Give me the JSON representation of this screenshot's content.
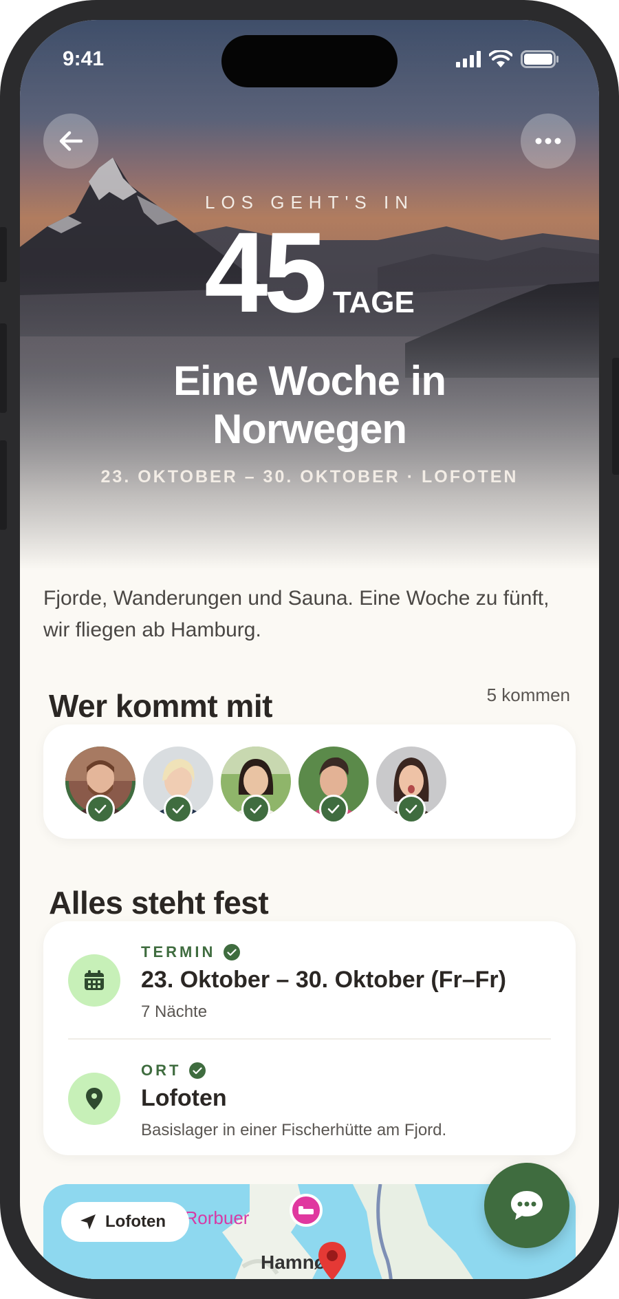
{
  "status_bar": {
    "time": "9:41"
  },
  "hero": {
    "kicker": "LOS GEHT'S IN",
    "countdown_number": "45",
    "countdown_unit": "TAGE",
    "title_line1": "Eine Woche in",
    "title_line2": "Norwegen",
    "meta": "23. OKTOBER – 30. OKTOBER · LOFOTEN"
  },
  "intro": "Fjorde, Wanderungen und Sauna. Eine Woche zu fünft, wir fliegen ab Hamburg.",
  "guests": {
    "title": "Wer kommt mit",
    "count_label": "5 kommen",
    "people": [
      {
        "name": "guest-1",
        "confirmed": true
      },
      {
        "name": "guest-2",
        "confirmed": true
      },
      {
        "name": "guest-3",
        "confirmed": true
      },
      {
        "name": "guest-4",
        "confirmed": true
      },
      {
        "name": "guest-5",
        "confirmed": true
      }
    ]
  },
  "fixed": {
    "title": "Alles steht fest",
    "date": {
      "label": "TERMIN",
      "value": "23. Oktober – 30. Oktober (Fr–Fr)",
      "sub": "7 Nächte",
      "icon": "calendar-icon"
    },
    "place": {
      "label": "ORT",
      "value": "Lofoten",
      "sub": "Basislager in einer Fischerhütte am Fjord.",
      "icon": "map-pin-icon"
    }
  },
  "map": {
    "chip_label": "Lofoten",
    "poi_label": "Eliassen Rorbuer",
    "town_label": "Hamnøy"
  },
  "colors": {
    "accent_green": "#3f6c3f",
    "icon_bg_green": "#c7f0b8",
    "background": "#fbf9f4"
  }
}
